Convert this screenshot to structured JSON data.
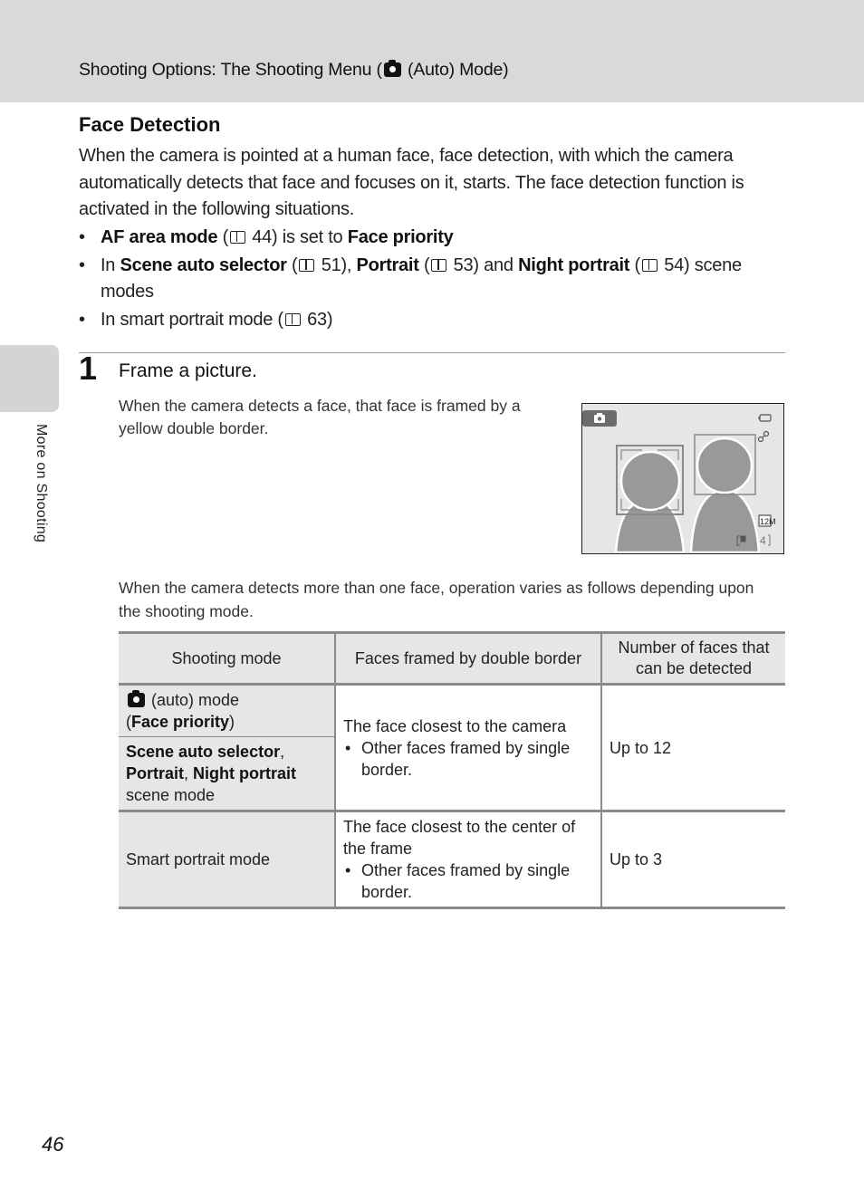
{
  "header": {
    "title_prefix": "Shooting Options: The Shooting Menu (",
    "title_icon": "camera-auto-icon",
    "title_suffix": " (Auto) Mode)"
  },
  "side_tab": {
    "label": "More on Shooting"
  },
  "section": {
    "title": "Face Detection",
    "intro": "When the camera is pointed at a human face, face detection, with which the camera automatically detects that face and focuses on it, starts. The face detection function is activated in the following situations.",
    "bullets": [
      {
        "parts": [
          {
            "b": "AF area mode"
          },
          {
            "t": " ("
          },
          {
            "icon": "book"
          },
          {
            "t": " 44) is set to "
          },
          {
            "b": "Face priority"
          }
        ]
      },
      {
        "parts": [
          {
            "t": "In "
          },
          {
            "b": "Scene auto selector"
          },
          {
            "t": " ("
          },
          {
            "icon": "book"
          },
          {
            "t": " 51), "
          },
          {
            "b": "Portrait"
          },
          {
            "t": " ("
          },
          {
            "icon": "book"
          },
          {
            "t": " 53) and "
          },
          {
            "b": "Night portrait"
          },
          {
            "t": " ("
          },
          {
            "icon": "book"
          },
          {
            "t": " 54) scene modes"
          }
        ]
      },
      {
        "parts": [
          {
            "t": "In smart portrait mode ("
          },
          {
            "icon": "book"
          },
          {
            "t": " 63)"
          }
        ]
      }
    ]
  },
  "step": {
    "number": "1",
    "title": "Frame a picture.",
    "description": "When the camera detects a face, that face is framed by a yellow double border.",
    "multi_face_text": "When the camera detects more than one face, operation varies as follows depending upon the shooting mode."
  },
  "lcd": {
    "mode_icon": "camera-auto-icon",
    "battery_icon": "battery-icon",
    "vr_icon": "vibration-reduction-icon",
    "image_size": "12M",
    "memory_icon": "internal-memory-icon",
    "exposures_remaining": "4"
  },
  "table": {
    "headers": [
      "Shooting mode",
      "Faces framed by double border",
      "Number of faces that can be detected"
    ],
    "rows": [
      {
        "modes": [
          {
            "icon": "camera-auto-icon",
            "t1": " (auto) mode",
            "t2_pre": "(",
            "b": "Face priority",
            "t2_post": ")"
          },
          {
            "b1": "Scene auto selector",
            "t1": ",",
            "b2": "Portrait",
            "t2": ", ",
            "b3": "Night portrait",
            "t3": "scene mode"
          }
        ],
        "framed": "The face closest to the camera",
        "framed_bullet": "Other faces framed by single border.",
        "count": "Up to 12"
      },
      {
        "mode": "Smart portrait mode",
        "framed": "The face closest to the center of the frame",
        "framed_bullet": "Other faces framed by single border.",
        "count": "Up to 3"
      }
    ]
  },
  "page_number": "46"
}
